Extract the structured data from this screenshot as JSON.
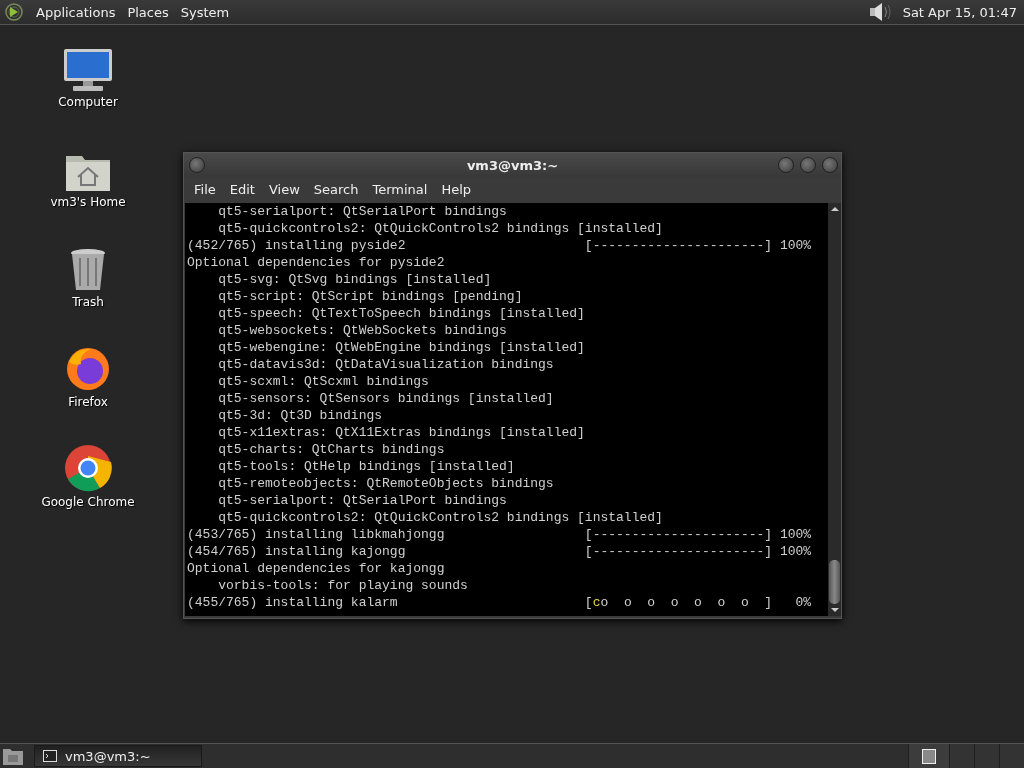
{
  "top_panel": {
    "menus": [
      "Applications",
      "Places",
      "System"
    ],
    "clock": "Sat Apr 15, 01:47"
  },
  "desktop_icons": [
    {
      "kind": "computer",
      "label": "Computer"
    },
    {
      "kind": "home",
      "label": "vm3's Home"
    },
    {
      "kind": "trash",
      "label": "Trash"
    },
    {
      "kind": "firefox",
      "label": "Firefox"
    },
    {
      "kind": "chrome",
      "label": "Google Chrome"
    }
  ],
  "window": {
    "title": "vm3@vm3:~",
    "menu": [
      "File",
      "Edit",
      "View",
      "Search",
      "Terminal",
      "Help"
    ],
    "lines": [
      {
        "kind": "text",
        "text": "    qt5-serialport: QtSerialPort bindings"
      },
      {
        "kind": "text",
        "text": "    qt5-quickcontrols2: QtQuickControls2 bindings [installed]"
      },
      {
        "kind": "text",
        "text": "(452/765) installing pyside2                       [----------------------] 100%"
      },
      {
        "kind": "text",
        "text": "Optional dependencies for pyside2"
      },
      {
        "kind": "text",
        "text": "    qt5-svg: QtSvg bindings [installed]"
      },
      {
        "kind": "text",
        "text": "    qt5-script: QtScript bindings [pending]"
      },
      {
        "kind": "text",
        "text": "    qt5-speech: QtTextToSpeech bindings [installed]"
      },
      {
        "kind": "text",
        "text": "    qt5-websockets: QtWebSockets bindings"
      },
      {
        "kind": "text",
        "text": "    qt5-webengine: QtWebEngine bindings [installed]"
      },
      {
        "kind": "text",
        "text": "    qt5-datavis3d: QtDataVisualization bindings"
      },
      {
        "kind": "text",
        "text": "    qt5-scxml: QtScxml bindings"
      },
      {
        "kind": "text",
        "text": "    qt5-sensors: QtSensors bindings [installed]"
      },
      {
        "kind": "text",
        "text": "    qt5-3d: Qt3D bindings"
      },
      {
        "kind": "text",
        "text": "    qt5-x11extras: QtX11Extras bindings [installed]"
      },
      {
        "kind": "text",
        "text": "    qt5-charts: QtCharts bindings"
      },
      {
        "kind": "text",
        "text": "    qt5-tools: QtHelp bindings [installed]"
      },
      {
        "kind": "text",
        "text": "    qt5-remoteobjects: QtRemoteObjects bindings"
      },
      {
        "kind": "text",
        "text": "    qt5-serialport: QtSerialPort bindings"
      },
      {
        "kind": "text",
        "text": "    qt5-quickcontrols2: QtQuickControls2 bindings [installed]"
      },
      {
        "kind": "text",
        "text": "(453/765) installing libkmahjongg                  [----------------------] 100%"
      },
      {
        "kind": "text",
        "text": "(454/765) installing kajongg                       [----------------------] 100%"
      },
      {
        "kind": "text",
        "text": "Optional dependencies for kajongg"
      },
      {
        "kind": "text",
        "text": "    vorbis-tools: for playing sounds"
      },
      {
        "kind": "pacman",
        "before": "(455/765) installing kalarm                        [",
        "pac": "c",
        "after": "o  o  o  o  o  o  o  ]   0%"
      }
    ]
  },
  "taskbar": {
    "tasks": [
      {
        "label": "vm3@vm3:~",
        "selected": false
      }
    ],
    "workspaces": [
      {
        "selected": true
      },
      {
        "selected": false
      },
      {
        "selected": false
      },
      {
        "selected": false
      }
    ]
  }
}
